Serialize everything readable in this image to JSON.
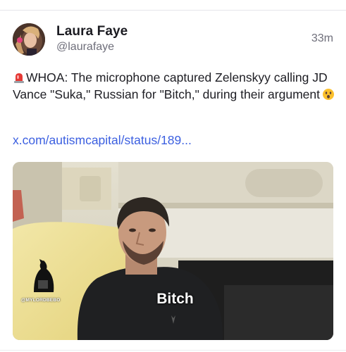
{
  "post": {
    "author_name": "Laura Faye",
    "author_handle": "@laurafaye",
    "timestamp": "33m",
    "text_before_emoji": "WHOA: The microphone captured Zelenskyy calling JD Vance \"Suka,\" Russian for \"Bitch,\" during their argument",
    "link_text": "x.com/autismcapital/status/189...",
    "leading_icon": "police-siren-icon",
    "trailing_icon": "astonished-face-icon"
  },
  "media": {
    "caption": "Bitch",
    "watermark": "@MYLORDBEBO"
  },
  "colors": {
    "link": "#3b5fe0",
    "name": "#1c1c22",
    "muted": "#6e6e7a"
  }
}
